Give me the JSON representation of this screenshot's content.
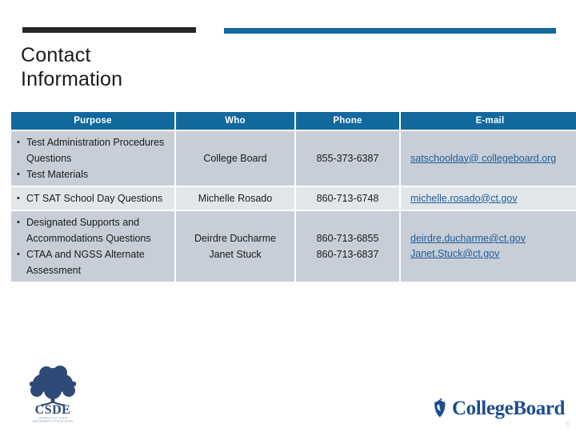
{
  "slide": {
    "title": "Contact\nInformation",
    "slide_number": "6",
    "accent_dark": "#262626",
    "accent_blue": "#12699e",
    "link_color": "#1d5c96",
    "row_shade_dark": "#c8ced8",
    "row_shade_light": "#e2e6eb"
  },
  "table": {
    "headers": [
      "Purpose",
      "Who",
      "Phone",
      "E-mail"
    ],
    "rows": [
      {
        "purpose_bullets": [
          "Test Administration Procedures Questions",
          "Test Materials"
        ],
        "who": [
          "College Board"
        ],
        "phone": [
          "855-373-6387"
        ],
        "email": [
          "satschoolday@ collegeboard.org"
        ]
      },
      {
        "purpose_bullets": [
          "CT SAT School Day Questions"
        ],
        "who": [
          "Michelle Rosado"
        ],
        "phone": [
          "860-713-6748"
        ],
        "email": [
          "michelle.rosado@ct.gov"
        ]
      },
      {
        "purpose_bullets": [
          "Designated Supports and Accommodations Questions",
          "CTAA and NGSS Alternate Assessment"
        ],
        "who": [
          "Deirdre Ducharme",
          "Janet Stuck"
        ],
        "phone": [
          "860-713-6855",
          "860-713-6837"
        ],
        "email": [
          "deirdre.ducharme@ct.gov",
          "Janet.Stuck@ct.gov"
        ]
      }
    ]
  },
  "logos": {
    "csde": {
      "name": "csde-logo",
      "acronym": "CSDE",
      "subtitle": "CONNECTICUT STATE DEPARTMENT OF EDUCATION",
      "color": "#2e4a77"
    },
    "college_board": {
      "name": "college-board-logo",
      "wordmark": "CollegeBoard",
      "color": "#1d4e8f"
    }
  }
}
